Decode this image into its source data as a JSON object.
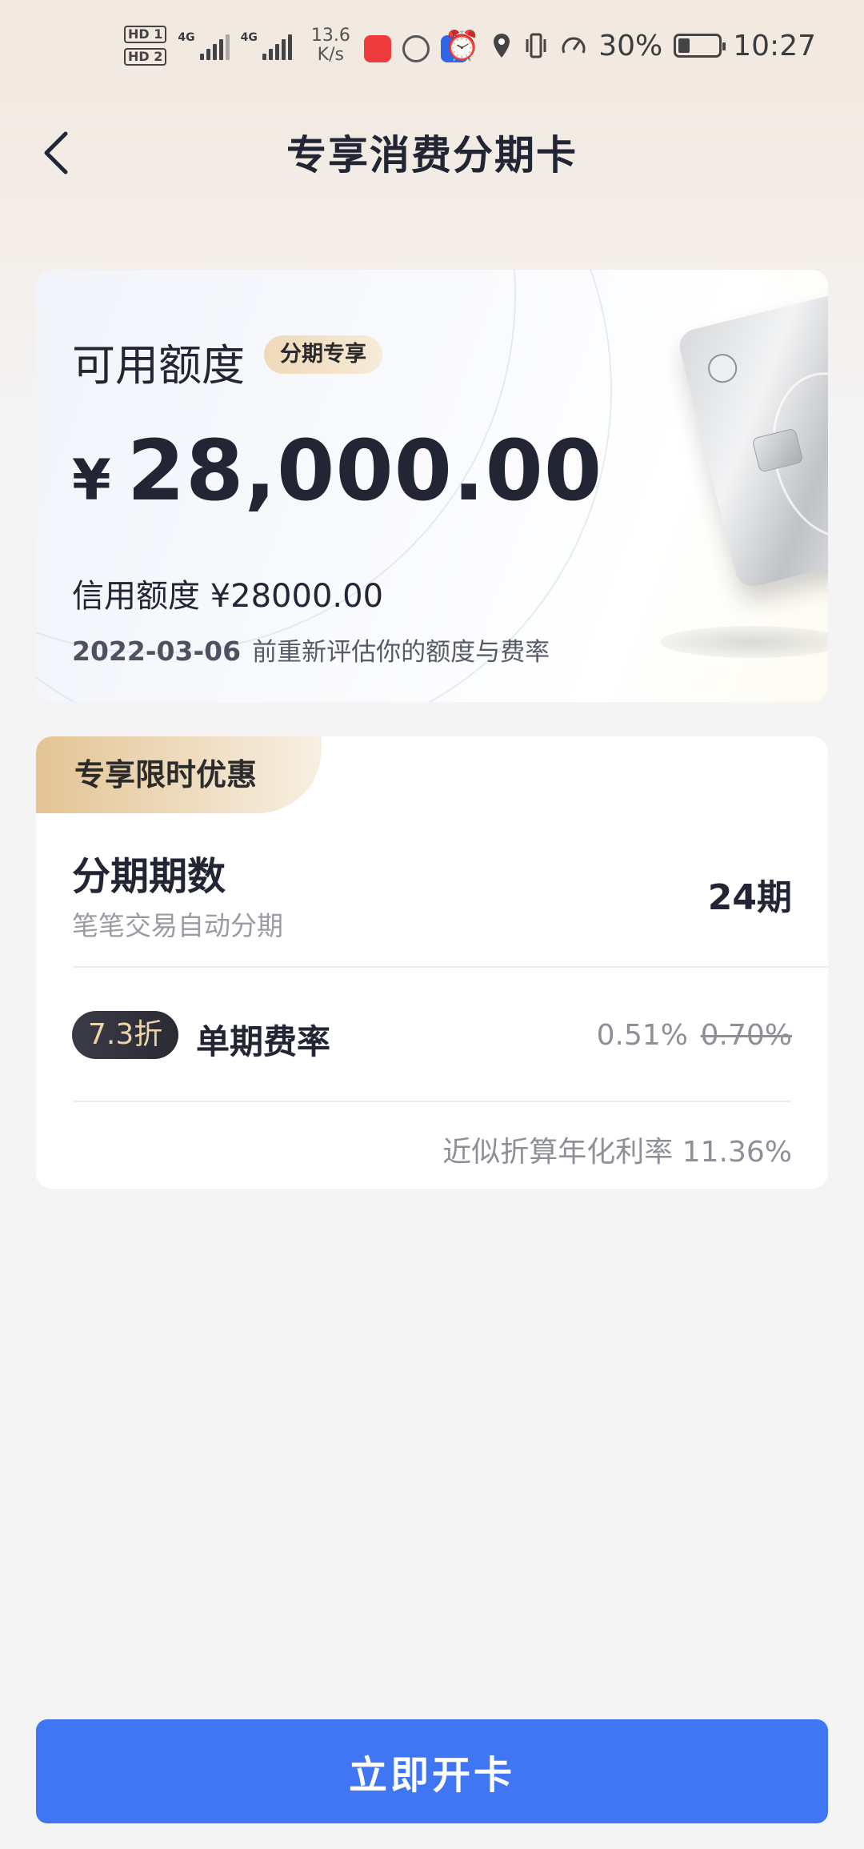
{
  "status_bar": {
    "hd1": "HD 1",
    "hd2": "HD 2",
    "net1": "4G",
    "net2": "4G",
    "speed_value": "13.6",
    "speed_unit": "K/s",
    "battery": "30%",
    "time": "10:27"
  },
  "nav": {
    "title": "专享消费分期卡"
  },
  "limit_card": {
    "available_label": "可用额度",
    "badge": "分期专享",
    "currency": "¥",
    "amount": "28,000.00",
    "credit_line": "信用额度 ¥28000.00",
    "reeval_date": "2022-03-06",
    "reeval_text": "前重新评估你的额度与费率"
  },
  "promo": {
    "tag": "专享限时优惠",
    "term_title": "分期期数",
    "term_sub": "笔笔交易自动分期",
    "term_value": "24期",
    "discount": "7.3折",
    "rate_label": "单期费率",
    "rate_now": "0.51%",
    "rate_old": "0.70%",
    "annual": "近似折算年化利率 11.36%"
  },
  "cta": {
    "label": "立即开卡"
  }
}
